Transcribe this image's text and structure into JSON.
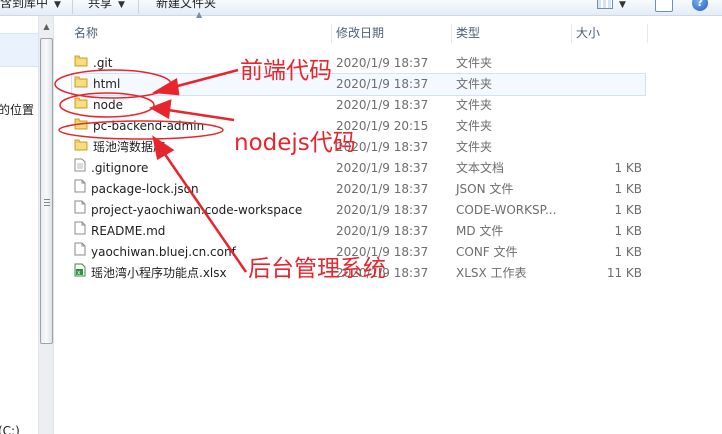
{
  "toolbar": {
    "include_in_library": "含到库中",
    "share": "共享",
    "new_folder": "新建文件夹"
  },
  "nav": {
    "item_location": "的位置",
    "item_drive": "(C:)"
  },
  "columns": {
    "name": "名称",
    "date": "修改日期",
    "type": "类型",
    "size": "大小"
  },
  "files": [
    {
      "name": ".git",
      "date": "2020/1/9 18:37",
      "type": "文件夹",
      "size": "",
      "icon": "folder-icon"
    },
    {
      "name": "html",
      "date": "2020/1/9 18:37",
      "type": "文件夹",
      "size": "",
      "icon": "folder-icon"
    },
    {
      "name": "node",
      "date": "2020/1/9 18:37",
      "type": "文件夹",
      "size": "",
      "icon": "folder-icon"
    },
    {
      "name": "pc-backend-admin",
      "date": "2020/1/9 20:15",
      "type": "文件夹",
      "size": "",
      "icon": "folder-icon"
    },
    {
      "name": "瑶池湾数据库",
      "date": "2020/1/9 18:37",
      "type": "文件夹",
      "size": "",
      "icon": "folder-icon"
    },
    {
      "name": ".gitignore",
      "date": "2020/1/9 18:37",
      "type": "文本文档",
      "size": "1 KB",
      "icon": "text-file-icon"
    },
    {
      "name": "package-lock.json",
      "date": "2020/1/9 18:37",
      "type": "JSON 文件",
      "size": "1 KB",
      "icon": "file-icon"
    },
    {
      "name": "project-yaochiwan.code-workspace",
      "date": "2020/1/9 18:37",
      "type": "CODE-WORKSP...",
      "size": "1 KB",
      "icon": "file-icon"
    },
    {
      "name": "README.md",
      "date": "2020/1/9 18:37",
      "type": "MD 文件",
      "size": "1 KB",
      "icon": "file-icon"
    },
    {
      "name": "yaochiwan.bluej.cn.conf",
      "date": "2020/1/9 18:37",
      "type": "CONF 文件",
      "size": "1 KB",
      "icon": "file-icon"
    },
    {
      "name": "瑶池湾小程序功能点.xlsx",
      "date": "2020/1/9 18:37",
      "type": "XLSX 工作表",
      "size": "11 KB",
      "icon": "excel-icon"
    }
  ],
  "annotations": {
    "frontend": "前端代码",
    "nodejs": "nodejs代码",
    "backend": "后台管理系统",
    "color": "#e8252d"
  }
}
